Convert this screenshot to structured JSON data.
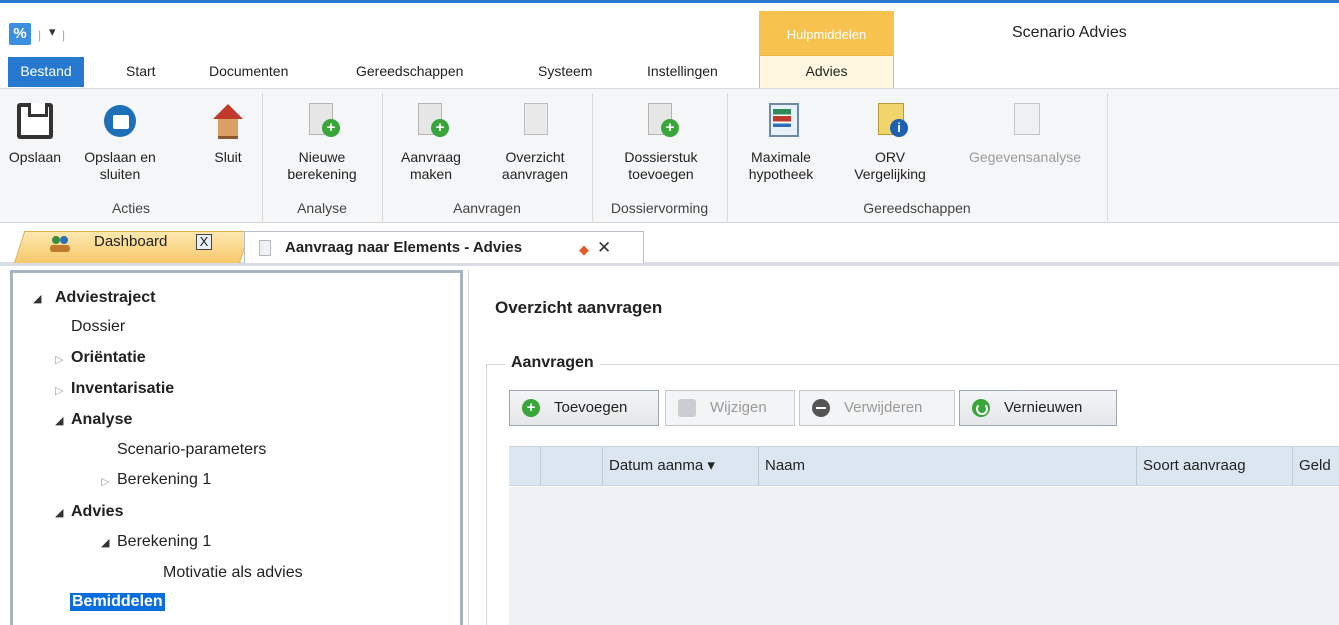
{
  "window": {
    "title": "Scenario Advies",
    "context_group": "Hulpmiddelen",
    "quick_access_dropdown": "▾"
  },
  "ribbon_tabs": [
    {
      "label": "Bestand"
    },
    {
      "label": "Start"
    },
    {
      "label": "Documenten"
    },
    {
      "label": "Gereedschappen"
    },
    {
      "label": "Systeem"
    },
    {
      "label": "Instellingen"
    },
    {
      "label": "Advies"
    }
  ],
  "ribbon": {
    "groups": {
      "acties": "Acties",
      "analyse": "Analyse",
      "aanvragen": "Aanvragen",
      "dossiervorming": "Dossiervorming",
      "gereedschappen": "Gereedschappen"
    },
    "buttons": {
      "opslaan": "Opslaan",
      "opslaan_sluiten_1": "Opslaan en",
      "opslaan_sluiten_2": "sluiten",
      "sluit": "Sluit",
      "nieuwe_1": "Nieuwe",
      "nieuwe_2": "berekening",
      "aanvraag_1": "Aanvraag",
      "aanvraag_2": "maken",
      "overzicht_1": "Overzicht",
      "overzicht_2": "aanvragen",
      "dossierstuk_1": "Dossierstuk",
      "dossierstuk_2": "toevoegen",
      "maximale_1": "Maximale",
      "maximale_2": "hypotheek",
      "orv_1": "ORV",
      "orv_2": "Vergelijking",
      "gegevensanalyse": "Gegevensanalyse"
    }
  },
  "document_tabs": {
    "dashboard": "Dashboard",
    "dashboard_close": "X",
    "active": "Aanvraag naar Elements - Advies",
    "active_dirty": "◆",
    "active_close": "✕"
  },
  "tree": {
    "adviestraject": "Adviestraject",
    "dossier": "Dossier",
    "orientatie": "Oriëntatie",
    "inventarisatie": "Inventarisatie",
    "analyse": "Analyse",
    "scenario_parameters": "Scenario-parameters",
    "berekening_1a": "Berekening 1",
    "advies": "Advies",
    "berekening_1b": "Berekening 1",
    "motivatie": "Motivatie als advies",
    "bemiddelen": "Bemiddelen"
  },
  "main": {
    "title": "Overzicht aanvragen",
    "groupbox": "Aanvragen",
    "toolbar": {
      "add": "Toevoegen",
      "edit": "Wijzigen",
      "delete": "Verwijderen",
      "refresh": "Vernieuwen"
    },
    "columns": {
      "datum": "Datum aanma",
      "sort_indicator": "▾",
      "naam": "Naam",
      "soort": "Soort aanvraag",
      "geld": "Geld"
    }
  }
}
